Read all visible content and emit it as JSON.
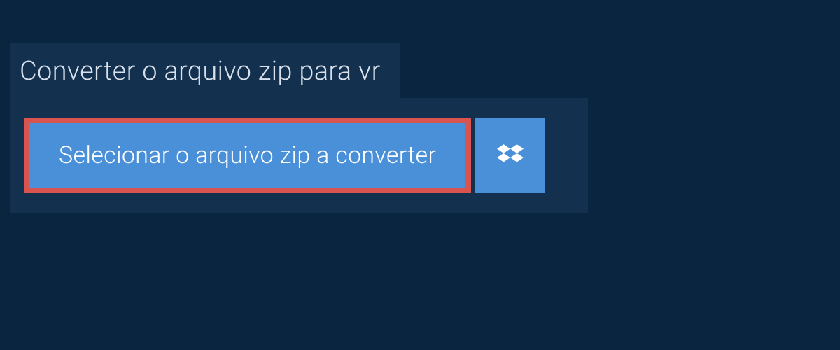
{
  "header": {
    "title": "Converter o arquivo zip para vr"
  },
  "actions": {
    "select_label": "Selecionar o arquivo zip a converter"
  }
}
